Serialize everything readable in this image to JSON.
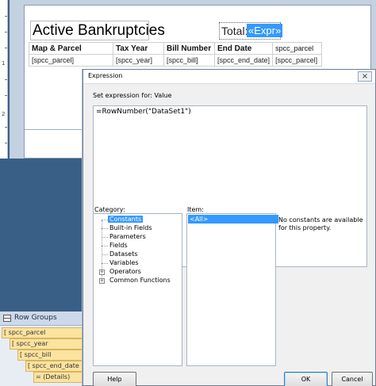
{
  "report": {
    "title": "Active Bankruptcies",
    "total_label": "Total:",
    "expr_placeholder": "«Expr»",
    "ruler_numbers": [
      "1",
      "2"
    ],
    "columns": [
      "Map & Parcel",
      "Tax Year",
      "Bill Number",
      "End Date",
      "spcc_parcel"
    ],
    "row": [
      "[spcc_parcel]",
      "[spcc_year]",
      "[spcc_bill]",
      "[spcc_end_date]",
      "[spcc_parcel]"
    ]
  },
  "row_groups": {
    "title": "Row Groups",
    "items": [
      "[ spcc_parcel",
      "[ spcc_year",
      "[ spcc_bill",
      "[ spcc_end_date",
      "= (Details)"
    ]
  },
  "dialog": {
    "title": "Expression",
    "close_glyph": "×",
    "set_expression_label": "Set expression for: Value",
    "expression": "=RowNumber(\"DataSet1\")",
    "category_label": "Category:",
    "item_label": "Item:",
    "categories": [
      "Constants",
      "Built-in Fields",
      "Parameters",
      "Fields",
      "Datasets",
      "Variables",
      "Operators",
      "Common Functions"
    ],
    "items": [
      "<All>"
    ],
    "description": "No constants are available for this property.",
    "buttons": {
      "help": "Help",
      "ok": "OK",
      "cancel": "Cancel"
    }
  }
}
